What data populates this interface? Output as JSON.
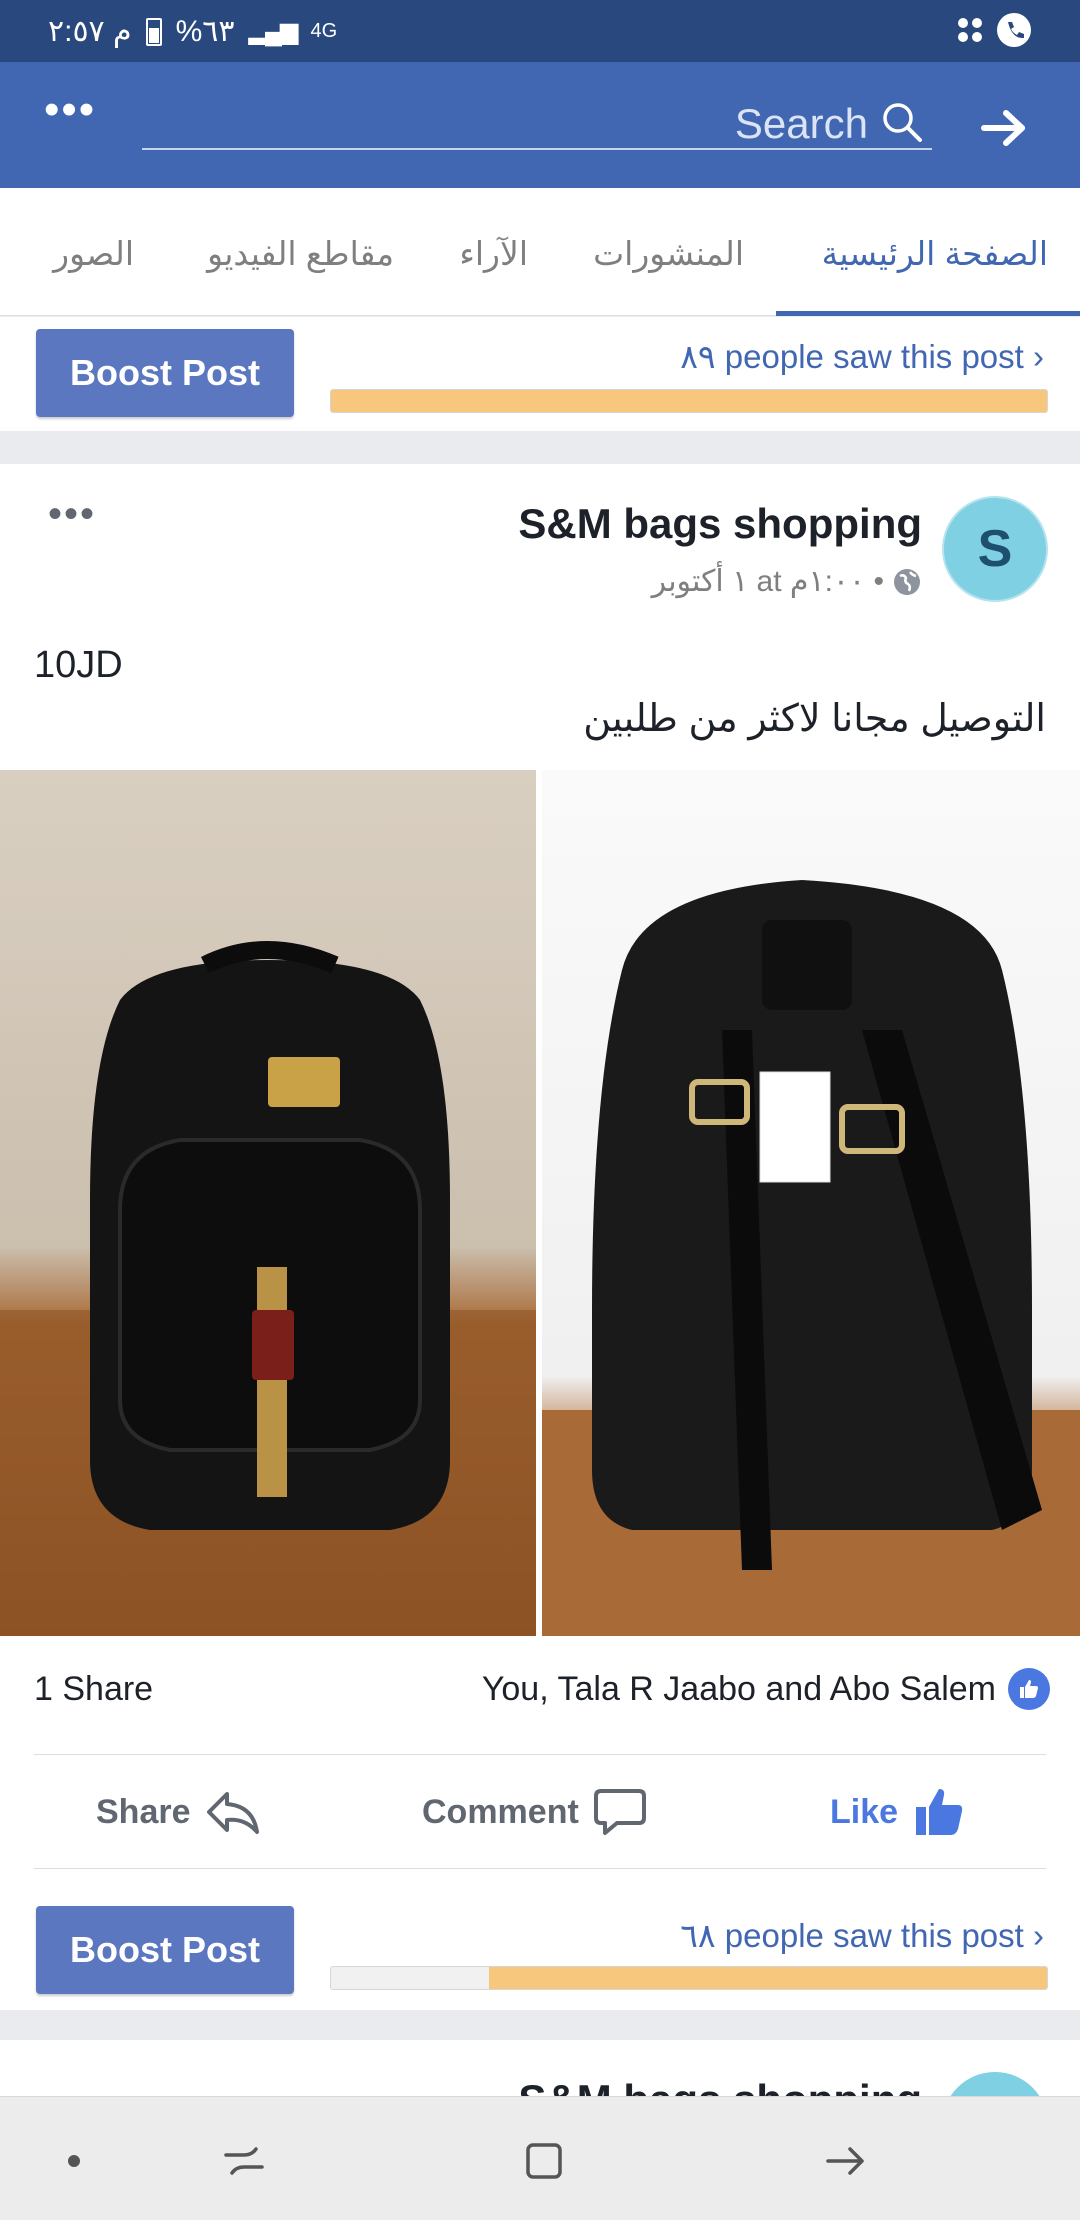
{
  "status_bar": {
    "time": "م ٢:٥٧",
    "battery": "%٦٣",
    "network": "4G"
  },
  "header": {
    "search_placeholder": "Search"
  },
  "tabs": [
    {
      "label": "الصفحة الرئيسية",
      "active": true
    },
    {
      "label": "المنشورات",
      "active": false
    },
    {
      "label": "الآراء",
      "active": false
    },
    {
      "label": "مقاطع الفيديو",
      "active": false
    },
    {
      "label": "الصور",
      "active": false
    }
  ],
  "boost_top": {
    "button_label": "Boost Post",
    "saw_text": "٨٩ people saw this post",
    "progress_fraction": 1.0
  },
  "post": {
    "page_name": "S&M bags shopping",
    "avatar_letter": "S",
    "meta": "١ أكتوبر at ١:٠٠م •",
    "price": "10JD",
    "caption": "التوصيل مجانا لاكثر من طلبين",
    "share_count": "1 Share",
    "reactors": "You, Tala R Jaabo and Abo Salem",
    "actions": {
      "share": "Share",
      "comment": "Comment",
      "like": "Like"
    }
  },
  "boost_bottom": {
    "button_label": "Boost Post",
    "saw_text": "٦٨ people saw this post",
    "progress_fraction": 0.78
  },
  "post2": {
    "page_name": "S&M bags shopping"
  },
  "colors": {
    "brand_blue": "#4267b2",
    "status_bar": "#29487d",
    "progress_orange": "#f7c77e",
    "like_blue": "#4a77e0"
  }
}
